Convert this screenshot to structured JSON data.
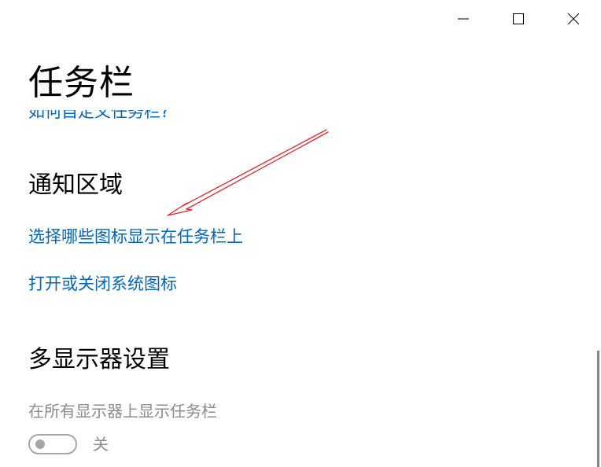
{
  "window": {
    "minimize_glyph": "—",
    "controls": [
      "minimize-icon",
      "maximize-icon",
      "close-icon"
    ]
  },
  "page": {
    "title": "任务栏",
    "partially_hidden_link": "如何自定义任务栏?"
  },
  "notification_area": {
    "title": "通知区域",
    "link_select_icons": "选择哪些图标显示在任务栏上",
    "link_system_icons": "打开或关闭系统图标"
  },
  "multi_display": {
    "title": "多显示器设置",
    "show_taskbar_label": "在所有显示器上显示任务栏",
    "toggle_state": "关"
  },
  "colors": {
    "link": "#0067b8",
    "disabled_text": "#8c8c8c",
    "annotation_arrow": "#e0252b"
  },
  "annotation": {
    "type": "arrow",
    "points_to": "选择哪些图标显示在任务栏上"
  }
}
